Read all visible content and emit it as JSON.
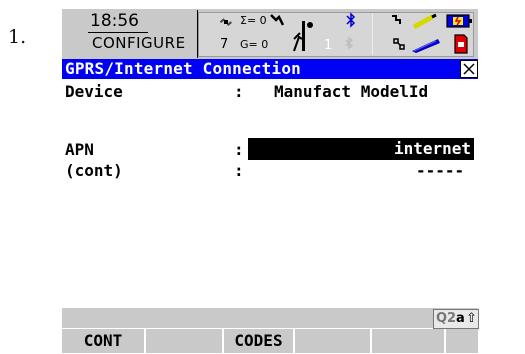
{
  "step": {
    "number": "1."
  },
  "status": {
    "time": "18:56",
    "mode": "CONFIGURE",
    "sat_summary": "Σ= 0",
    "satellites": "7",
    "glonass": "G= 0",
    "rtk_count": "1",
    "icons": [
      "satellite-icon",
      "signal-icon",
      "pole-icon",
      "bluetooth-icon",
      "corner-icon",
      "link-icon",
      "pen-icon",
      "stylus-icon",
      "battery-icon",
      "memory-card-icon"
    ]
  },
  "panel": {
    "title": "GPRS/Internet Connection",
    "close": "×"
  },
  "fields": {
    "device": {
      "label": "Device",
      "sep": ":",
      "value": "Manufact ModelId"
    },
    "apn": {
      "label": "APN",
      "sep": ":",
      "value": "internet"
    },
    "cont": {
      "label": "(cont)",
      "sep": ":",
      "value": "-----"
    }
  },
  "indicator": {
    "q2": "Q2",
    "mode": "a",
    "shift": "⇧"
  },
  "function_keys": [
    "CONT",
    "",
    "CODES",
    "",
    "",
    ""
  ]
}
